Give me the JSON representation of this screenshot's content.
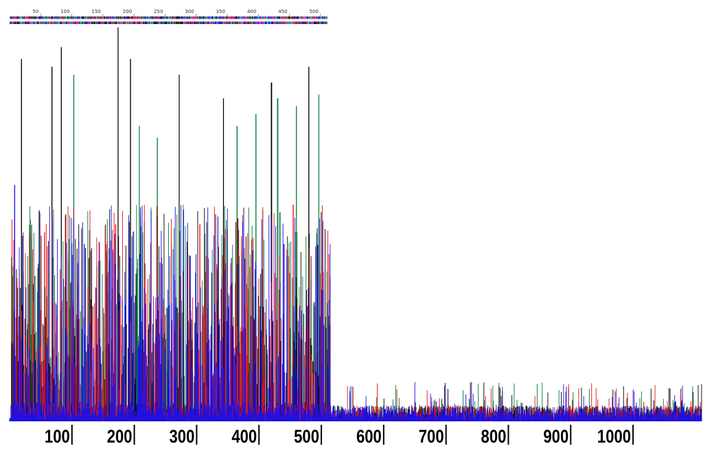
{
  "chart_data": {
    "type": "line",
    "x_axis": {
      "ticks": [
        100,
        200,
        300,
        400,
        500,
        600,
        700,
        800,
        900,
        1000
      ],
      "labels": [
        "100",
        "200",
        "300",
        "400",
        "500",
        "600",
        "700",
        "800",
        "900",
        "1000"
      ],
      "xlim": [
        0,
        1110
      ]
    },
    "y_axis": {
      "ylim": [
        0,
        1.0
      ]
    },
    "sequence_track": {
      "ticks": [
        50,
        100,
        150,
        200,
        250,
        300,
        350,
        400,
        450,
        500
      ],
      "labels": [
        "50",
        "100",
        "150",
        "200",
        "250",
        "300",
        "350",
        "400",
        "450",
        "500"
      ],
      "range": [
        0,
        510
      ]
    },
    "signal_end": 515,
    "series": [
      {
        "color": "#000000",
        "tallest_peaks": [
          {
            "x": 19,
            "y": 0.92
          },
          {
            "x": 68,
            "y": 0.9
          },
          {
            "x": 83,
            "y": 0.95
          },
          {
            "x": 174,
            "y": 1.0
          },
          {
            "x": 194,
            "y": 0.92
          },
          {
            "x": 272,
            "y": 0.88
          },
          {
            "x": 343,
            "y": 0.82
          },
          {
            "x": 420,
            "y": 0.86
          },
          {
            "x": 480,
            "y": 0.9
          }
        ]
      },
      {
        "color": "#0a7a3a",
        "tallest_peaks": [
          {
            "x": 103,
            "y": 0.88
          },
          {
            "x": 208,
            "y": 0.75
          },
          {
            "x": 237,
            "y": 0.72
          },
          {
            "x": 365,
            "y": 0.75
          },
          {
            "x": 395,
            "y": 0.78
          },
          {
            "x": 430,
            "y": 0.82
          },
          {
            "x": 460,
            "y": 0.8
          },
          {
            "x": 496,
            "y": 0.83
          }
        ]
      },
      {
        "color": "#e8101a",
        "tallest_peaks": [
          {
            "x": 56,
            "y": 0.48
          },
          {
            "x": 170,
            "y": 0.5
          },
          {
            "x": 305,
            "y": 0.5
          },
          {
            "x": 455,
            "y": 0.55
          }
        ]
      },
      {
        "color": "#1a10e8",
        "tallest_peaks": [
          {
            "x": 8,
            "y": 0.6
          },
          {
            "x": 120,
            "y": 0.45
          },
          {
            "x": 290,
            "y": 0.42
          },
          {
            "x": 440,
            "y": 0.45
          }
        ]
      }
    ]
  },
  "colors": {
    "black_trace": "#000000",
    "green_trace": "#0a7a3a",
    "red_trace": "#e8101a",
    "blue_trace": "#1a10e8"
  }
}
